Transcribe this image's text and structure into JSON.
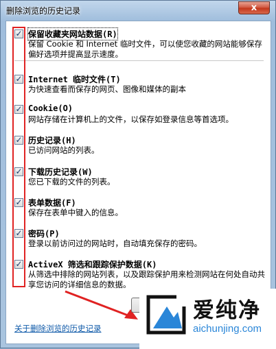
{
  "window": {
    "title": "删除浏览的历史记录",
    "close_glyph": "x"
  },
  "items": [
    {
      "title": "保留收藏夹网站数据(R)",
      "desc": "保留 Cookie 和 Internet 临时文件，可以使您收藏的网站能够保存偏好选项并提高显示速度。",
      "checked": true
    },
    {
      "title": "Internet 临时文件(T)",
      "desc": "为快速查看而保存的网页、图像和媒体的副本",
      "checked": true
    },
    {
      "title": "Cookie(O)",
      "desc": "网站存储在计算机上的文件，以保存如登录信息等首选项。",
      "checked": true
    },
    {
      "title": "历史记录(H)",
      "desc": "已访问网站的列表。",
      "checked": true
    },
    {
      "title": "下载历史记录(W)",
      "desc": "您已下载的文件的列表。",
      "checked": true
    },
    {
      "title": "表单数据(F)",
      "desc": "保存在表单中键入的信息。",
      "checked": true
    },
    {
      "title": "密码(P)",
      "desc": "登录以前访问过的网站时，自动填充保存的密码。",
      "checked": true
    },
    {
      "title": "ActiveX 筛选和跟踪保护数据(K)",
      "desc": "从筛选中排除的网站列表，以及跟踪保护用来检测网站在何处自动共享您访问的详细信息的数据。",
      "checked": true
    }
  ],
  "footer": {
    "link": "关于删除浏览的历史记录"
  },
  "watermark": {
    "brand": "爱纯净",
    "url": "aichunjing.com"
  },
  "colors": {
    "annotation_red": "#e02222",
    "link_blue": "#0c58a8",
    "watermark_blue": "#2a86d8"
  }
}
